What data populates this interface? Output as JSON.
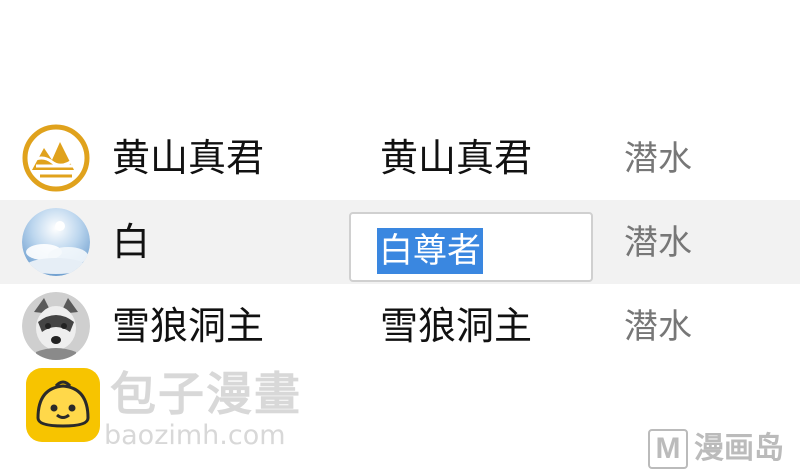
{
  "members": [
    {
      "avatar_icon": "mountain-logo-icon",
      "name": "黄山真君",
      "card_name": "黄山真君",
      "role": "潜水",
      "selected": false
    },
    {
      "avatar_icon": "sky-clouds-avatar-icon",
      "name": "白",
      "card_name": "白尊者",
      "role": "潜水",
      "selected": true
    },
    {
      "avatar_icon": "wolf-avatar-icon",
      "name": "雪狼洞主",
      "card_name": "雪狼洞主",
      "role": "潜水",
      "selected": false
    }
  ],
  "watermark": {
    "logo_icon": "steamed-bun-icon",
    "name": "包子漫畫",
    "url": "baozimh.com"
  },
  "corner_badge": {
    "letter": "M",
    "text": "漫画岛"
  },
  "colors": {
    "selection": "#3a87e0",
    "selected_row": "#f2f2f2",
    "role_text": "#777777",
    "logo_yellow": "#f7c400",
    "mountain_gold": "#e0a21c"
  }
}
